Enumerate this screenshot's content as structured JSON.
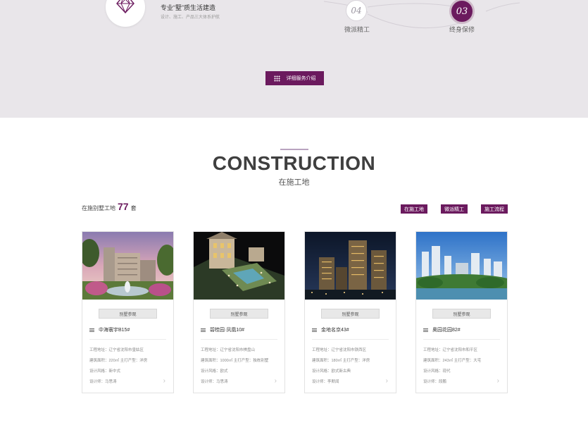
{
  "service": {
    "title": "专业“墅”质生活建造",
    "subtitle": "设计、施工、产品三大体系护航"
  },
  "steps": [
    {
      "num": "04",
      "label": "微派精工"
    },
    {
      "num": "03",
      "label": "终身保修"
    }
  ],
  "detail_button": "详细服务介绍",
  "section": {
    "title_en": "CONSTRUCTION",
    "title_cn": "在施工地"
  },
  "count": {
    "prefix": "在施别墅工地",
    "value": "77",
    "suffix": "套"
  },
  "tabs": [
    "在施工地",
    "微派精工",
    "施工流程"
  ],
  "cards": [
    {
      "view_label": "别墅参观",
      "name": "中海寰宇B15#",
      "address": "工程地址：辽宁省沈阳市皇姑区",
      "area": "建筑面积：220㎡ 主打产型：洋房",
      "style": "设计风格：新中式",
      "designer": "设计师：马思涛"
    },
    {
      "view_label": "别墅参观",
      "name": "碧桂园·凤凰10#",
      "address": "工程地址：辽宁省沈阳市棋盘山",
      "area": "建筑面积：1000㎡ 主打产型：独栋别墅",
      "style": "设计风格：欧式",
      "designer": "设计师：马思涛"
    },
    {
      "view_label": "别墅参观",
      "name": "金地名京43#",
      "address": "工程地址：辽宁省沈阳市铁西区",
      "area": "建筑面积：180㎡ 主打产型：洋房",
      "style": "设计风格：欧式新古典",
      "designer": "设计师：李默闻"
    },
    {
      "view_label": "别墅参观",
      "name": "奥园花园82#",
      "address": "工程地址：辽宁省沈阳市和平区",
      "area": "建筑面积：243㎡ 主打产型：大宅",
      "style": "设计风格：现代",
      "designer": "设计师：段鹏"
    }
  ]
}
